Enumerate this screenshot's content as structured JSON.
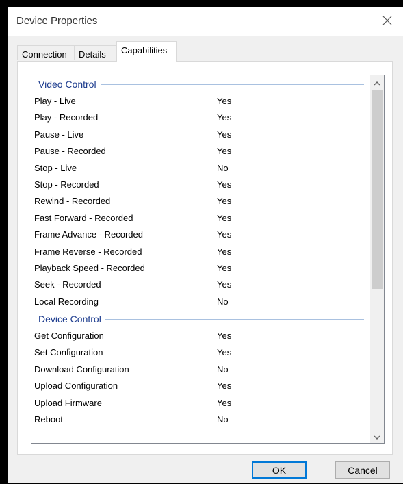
{
  "window": {
    "title": "Device Properties"
  },
  "tabs": [
    {
      "label": "Connection"
    },
    {
      "label": "Details"
    },
    {
      "label": "Capabilities"
    }
  ],
  "groups": [
    {
      "header": "Video Control",
      "rows": [
        {
          "name": "Play - Live",
          "value": "Yes"
        },
        {
          "name": "Play - Recorded",
          "value": "Yes"
        },
        {
          "name": "Pause - Live",
          "value": "Yes"
        },
        {
          "name": "Pause - Recorded",
          "value": "Yes"
        },
        {
          "name": "Stop - Live",
          "value": "No"
        },
        {
          "name": "Stop - Recorded",
          "value": "Yes"
        },
        {
          "name": "Rewind - Recorded",
          "value": "Yes"
        },
        {
          "name": "Fast Forward - Recorded",
          "value": "Yes"
        },
        {
          "name": "Frame Advance - Recorded",
          "value": "Yes"
        },
        {
          "name": "Frame Reverse - Recorded",
          "value": "Yes"
        },
        {
          "name": "Playback Speed - Recorded",
          "value": "Yes"
        },
        {
          "name": "Seek - Recorded",
          "value": "Yes"
        },
        {
          "name": "Local Recording",
          "value": "No"
        }
      ]
    },
    {
      "header": "Device Control",
      "rows": [
        {
          "name": "Get Configuration",
          "value": "Yes"
        },
        {
          "name": "Set Configuration",
          "value": "Yes"
        },
        {
          "name": "Download Configuration",
          "value": "No"
        },
        {
          "name": "Upload Configuration",
          "value": "Yes"
        },
        {
          "name": "Upload Firmware",
          "value": "Yes"
        },
        {
          "name": "Reboot",
          "value": "No"
        }
      ]
    }
  ],
  "buttons": {
    "ok": "OK",
    "cancel": "Cancel"
  },
  "icons": {
    "close": "close-icon",
    "scroll_up": "chevron-up-icon",
    "scroll_down": "chevron-down-icon"
  }
}
